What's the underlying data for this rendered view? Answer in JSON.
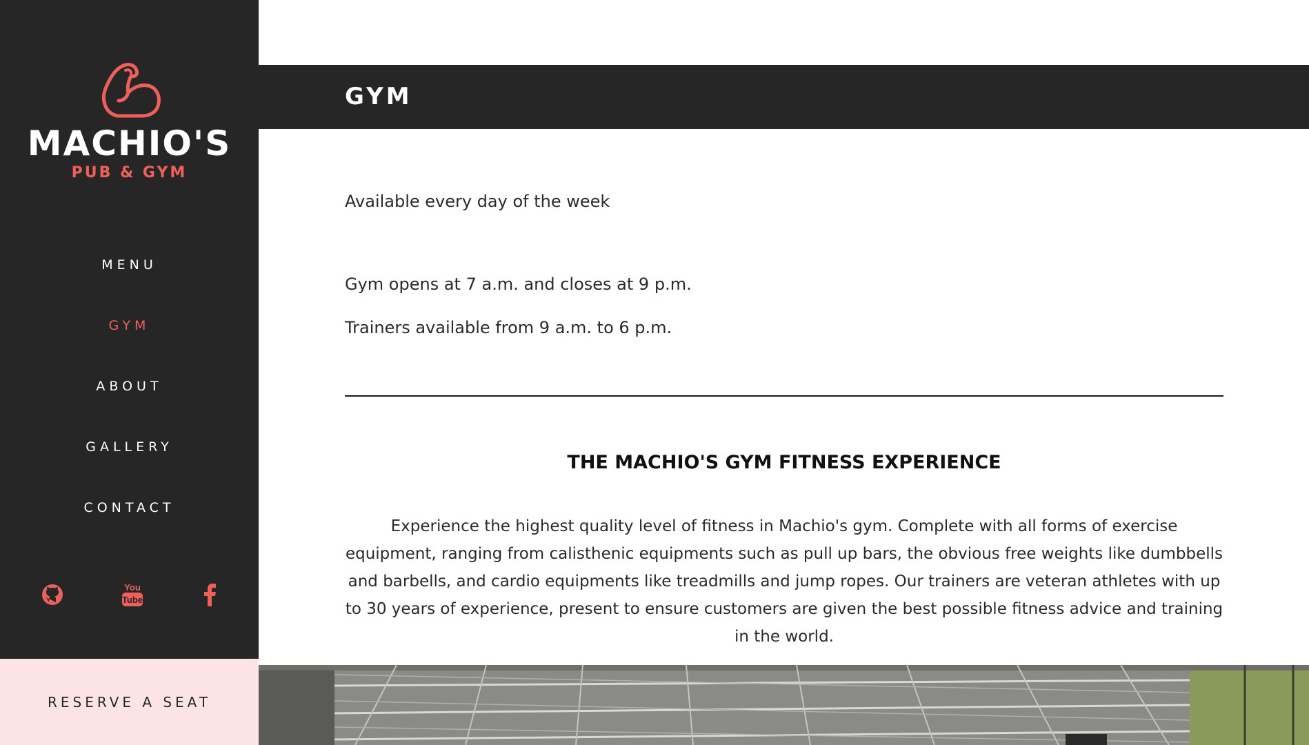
{
  "brand": {
    "name": "MACHIO'S",
    "tagline": "PUB & GYM"
  },
  "nav": {
    "items": [
      {
        "label": "MENU"
      },
      {
        "label": "GYM"
      },
      {
        "label": "ABOUT"
      },
      {
        "label": "GALLERY"
      },
      {
        "label": "CONTACT"
      }
    ],
    "active": "GYM"
  },
  "social": [
    "github-icon",
    "youtube-icon",
    "facebook-icon"
  ],
  "reserve_label": "RESERVE A SEAT",
  "page": {
    "title": "GYM",
    "availability": "Available every day of the week",
    "hours": "Gym opens at 7 a.m. and closes at 9 p.m.",
    "trainers": "Trainers available from 9 a.m. to 6 p.m."
  },
  "section": {
    "title": "THE MACHIO'S GYM FITNESS EXPERIENCE",
    "body": "Experience the highest quality level of fitness in Machio's gym. Complete with all forms of exercise equipment, ranging from calisthenic equipments such as pull up bars, the obvious free weights like dumbbells and barbells, and cardio equipments like treadmills and jump ropes. Our trainers are veteran athletes with up to 30 years of experience, present to ensure customers are given the best possible fitness advice and training in the world."
  },
  "colors": {
    "sidebar": "#262626",
    "accent": "#f0605a",
    "reserve_bg": "#fde4e4"
  }
}
